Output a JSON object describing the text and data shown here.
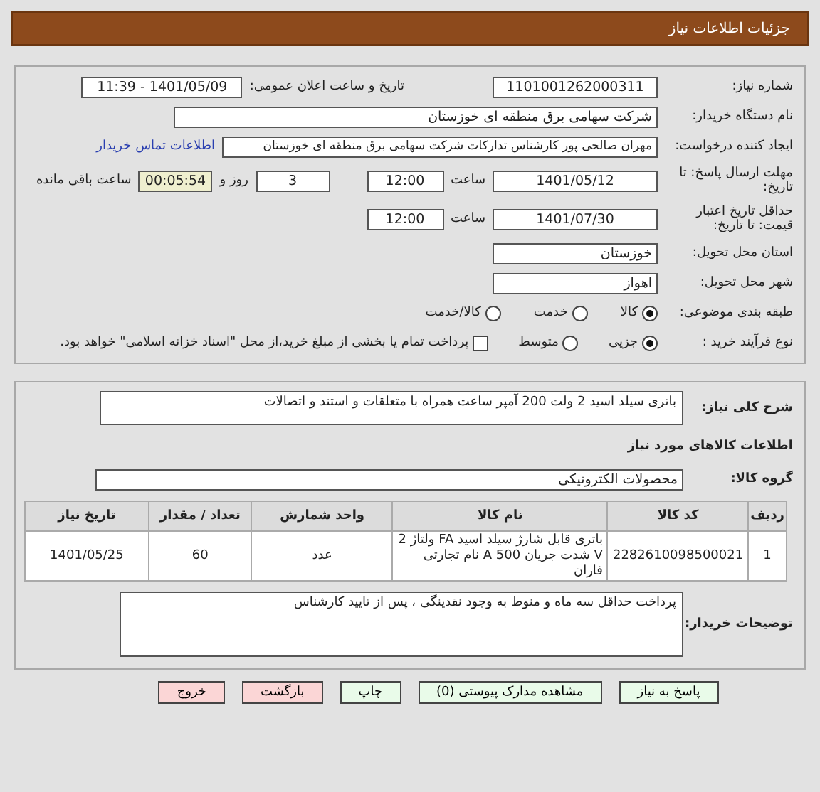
{
  "title": "جزئیات اطلاعات نیاز",
  "need_number": {
    "label": "شماره نیاز:",
    "value": "1101001262000311"
  },
  "announce": {
    "label": "تاریخ و ساعت اعلان عمومی:",
    "value": "1401/05/09 - 11:39"
  },
  "buyer_org": {
    "label": "نام دستگاه خریدار:",
    "value": "شرکت سهامی برق منطقه ای خوزستان"
  },
  "creator": {
    "label": "ایجاد کننده درخواست:",
    "value": "مهران صالحی پور کارشناس تدارکات شرکت سهامی برق منطقه ای خوزستان",
    "link": "اطلاعات تماس خریدار"
  },
  "deadline": {
    "label": "مهلت ارسال پاسخ: تا تاریخ:",
    "date": "1401/05/12",
    "time_label": "ساعت",
    "time": "12:00",
    "days": "3",
    "days_label": "روز و",
    "remaining": "00:05:54",
    "remaining_label": "ساعت باقی مانده"
  },
  "validity": {
    "label": "حداقل تاریخ اعتبار قیمت: تا تاریخ:",
    "date": "1401/07/30",
    "time_label": "ساعت",
    "time": "12:00"
  },
  "province": {
    "label": "استان محل تحویل:",
    "value": "خوزستان"
  },
  "city": {
    "label": "شهر محل تحویل:",
    "value": "اهواز"
  },
  "category": {
    "label": "طبقه بندی موضوعی:",
    "options": [
      {
        "label": "کالا",
        "selected": true
      },
      {
        "label": "خدمت",
        "selected": false
      },
      {
        "label": "کالا/خدمت",
        "selected": false
      }
    ]
  },
  "process": {
    "label": "نوع فرآیند خرید :",
    "options": [
      {
        "label": "جزیی",
        "selected": true
      },
      {
        "label": "متوسط",
        "selected": false
      }
    ],
    "checkbox": {
      "label": "پرداخت تمام یا بخشی از مبلغ خرید،از محل \"اسناد خزانه اسلامی\" خواهد بود.",
      "checked": false
    }
  },
  "description": {
    "label": "شرح کلی نیاز:",
    "value": "باتری سیلد اسید 2 ولت  200  آمپر  ساعت  همراه با متعلقات و استند و اتصالات"
  },
  "items_heading": "اطلاعات کالاهای مورد نیاز",
  "goods_group": {
    "label": "گروه کالا:",
    "value": "محصولات الکترونیکی"
  },
  "table": {
    "columns": [
      "ردیف",
      "کد کالا",
      "نام کالا",
      "واحد شمارش",
      "تعداد / مقدار",
      "تاریخ نیاز"
    ],
    "rows": [
      [
        "1",
        "2282610098500021",
        "باتری قابل شارژ سیلد اسید FA ولتاژ 2 V شدت جریان 500 A نام تجارتی فاران",
        "عدد",
        "60",
        "1401/05/25"
      ]
    ]
  },
  "buyer_notes": {
    "label": "توضیحات خریدار:",
    "value": "پرداخت حداقل سه ماه و منوط به وجود نقدینگی ، پس از تایید کارشناس"
  },
  "buttons": [
    {
      "label": "پاسخ به نیاز",
      "kind": "green"
    },
    {
      "label": "مشاهده مدارک پیوستی (0)",
      "kind": "green"
    },
    {
      "label": "چاپ",
      "kind": "green"
    },
    {
      "label": "بازگشت",
      "kind": "red"
    },
    {
      "label": "خروج",
      "kind": "red"
    }
  ]
}
